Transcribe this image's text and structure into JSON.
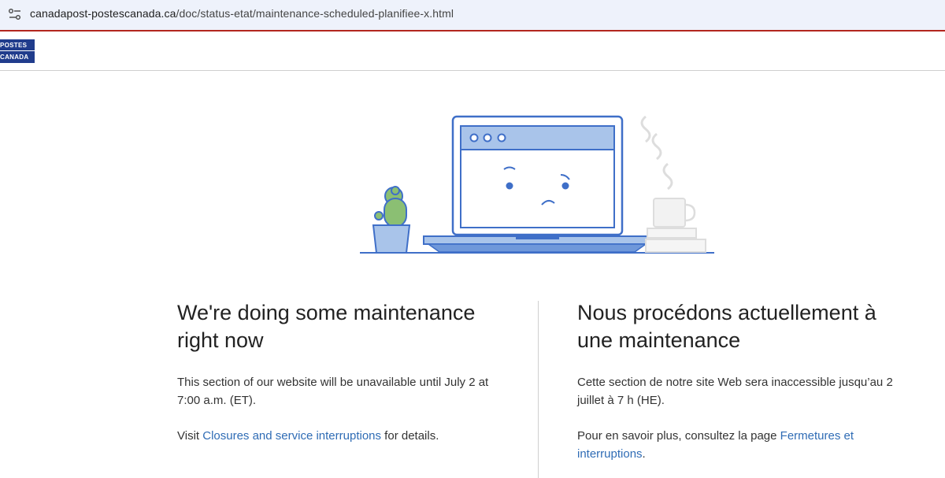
{
  "browser": {
    "url_host": "canadapost-postescanada.ca",
    "url_path": "/doc/status-etat/maintenance-scheduled-planifiee-x.html",
    "site_info_icon": "tune-icon"
  },
  "header": {
    "logo_line1": "POSTES",
    "logo_line2": "CANADA",
    "logo_color": "#203c8c"
  },
  "colors": {
    "accent_red": "#b3261e",
    "link": "#2f6cb5",
    "illustration_blue": "#3f6fc8",
    "illustration_fill": "#a9c4ea"
  },
  "english": {
    "heading": "We're doing some maintenance right now",
    "body": "This section of our website will be unavailable until July 2 at 7:00 a.m. (ET).",
    "visit_prefix": "Visit ",
    "visit_link": "Closures and service interruptions",
    "visit_suffix": " for details."
  },
  "french": {
    "heading": "Nous procédons actuellement à une maintenance",
    "body": "Cette section de notre site Web sera inaccessible jusqu’au 2 juillet à 7 h (HE).",
    "visit_prefix": "Pour en savoir plus, consultez la page ",
    "visit_link": "Fermetures et interruptions",
    "visit_suffix": "."
  }
}
